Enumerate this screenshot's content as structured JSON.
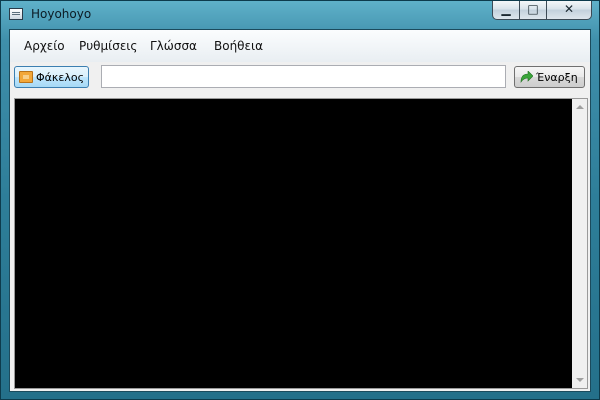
{
  "window": {
    "title": "Hoyohoyo",
    "controls": {
      "minimize": "▁",
      "maximize": "□",
      "close": "✕"
    }
  },
  "menu": {
    "items": [
      "Αρχείο",
      "Ρυθμίσεις",
      "Γλώσσα",
      "Βοήθεια"
    ]
  },
  "toolbar": {
    "folder_label": "Φάκελος",
    "path_value": "",
    "start_label": "Έναρξη"
  },
  "icons": {
    "app": "app-icon",
    "folder": "folder-icon",
    "start": "start-arrow-icon"
  },
  "colors": {
    "console_background": "#000000",
    "window_frame": "#2e7e99"
  }
}
